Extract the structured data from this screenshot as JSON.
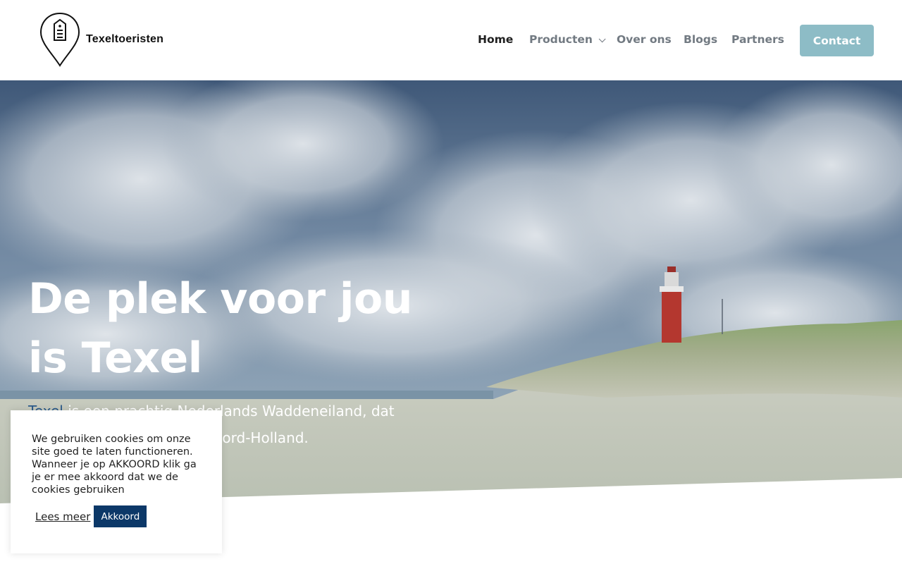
{
  "brand": {
    "name": "Texeltoeristen"
  },
  "nav": {
    "items": [
      {
        "label": "Home",
        "active": true
      },
      {
        "label": "Producten",
        "has_dropdown": true
      },
      {
        "label": "Over ons"
      },
      {
        "label": "Blogs"
      },
      {
        "label": "Partners"
      }
    ],
    "contact_label": "Contact"
  },
  "hero": {
    "title": "De plek voor jou is Texel",
    "intro_link": "Texel",
    "intro_rest": " is een prachtig Nederlands Waddeneiland, dat behoort tot de provincie Noord-Holland."
  },
  "cookie": {
    "text": "We gebruiken cookies om onze site goed te laten functioneren. Wanneer je op AKKOORD klik ga je er mee akkoord dat we de cookies gebruiken",
    "read_more": "Lees meer",
    "accept": "Akkoord"
  },
  "colors": {
    "accent": "#8dbcc6",
    "accept_button": "#0c3868",
    "nav_text": "#727a82",
    "lighthouse": "#c0312f"
  }
}
